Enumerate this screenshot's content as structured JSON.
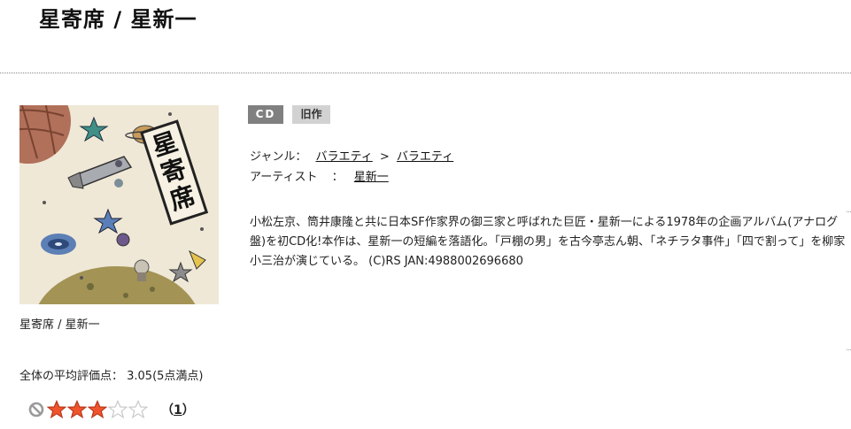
{
  "page": {
    "title": "星寄席 / 星新一"
  },
  "product": {
    "jacket_caption": "星寄席 / 星新一",
    "jacket_text": "星寄席",
    "format_tag": "CD",
    "status_tag": "旧作",
    "genre_label": "ジャンル：",
    "genre_parent": "バラエティ",
    "genre_separator": ">",
    "genre_child": "バラエティ",
    "artist_label": "アーティスト",
    "artist_colon": "：",
    "artist_name": "星新一",
    "description": "小松左京、筒井康隆と共に日本SF作家界の御三家と呼ばれた巨匠・星新一による1978年の企画アルバム(アナログ盤)を初CD化!本作は、星新一の短編を落語化。「戸棚の男」を古今亭志ん朝、「ネチラタ事件」「四で割って」を柳家小三治が演じている。 (C)RS JAN:4988002696680"
  },
  "rating": {
    "label": "全体の平均評価点： 3.05(5点満点)",
    "value": 3.05,
    "max": 5,
    "review_count_open": "（",
    "review_count": "1",
    "review_count_close": "）",
    "star_filled_color": "#f0542c",
    "star_empty_color": "#c8c8c8"
  },
  "icons": {
    "not_interested": "no-entry-icon",
    "star": "star-icon"
  }
}
